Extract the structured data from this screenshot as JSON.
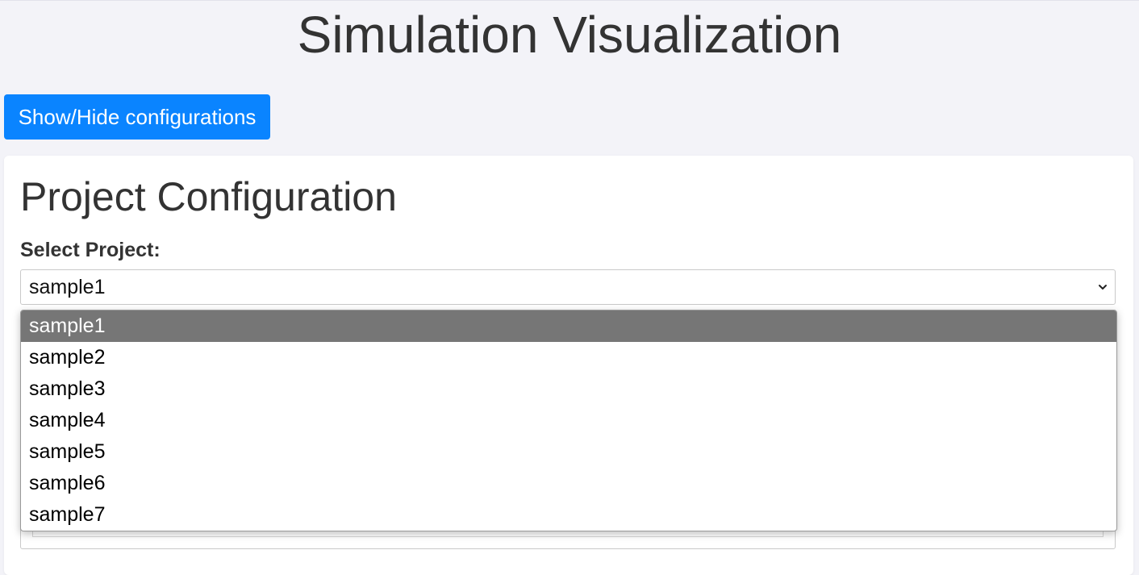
{
  "page": {
    "title": "Simulation Visualization"
  },
  "toolbar": {
    "toggle_label": "Show/Hide configurations"
  },
  "config": {
    "title": "Project Configuration",
    "select_label": "Select Project:",
    "selected_value": "sample1",
    "options": [
      "sample1",
      "sample2",
      "sample3",
      "sample4",
      "sample5",
      "sample6",
      "sample7"
    ],
    "highlighted_index": 0
  },
  "colors": {
    "primary_button": "#0a84ff",
    "highlight": "#767676",
    "background": "#f3f3f8"
  }
}
